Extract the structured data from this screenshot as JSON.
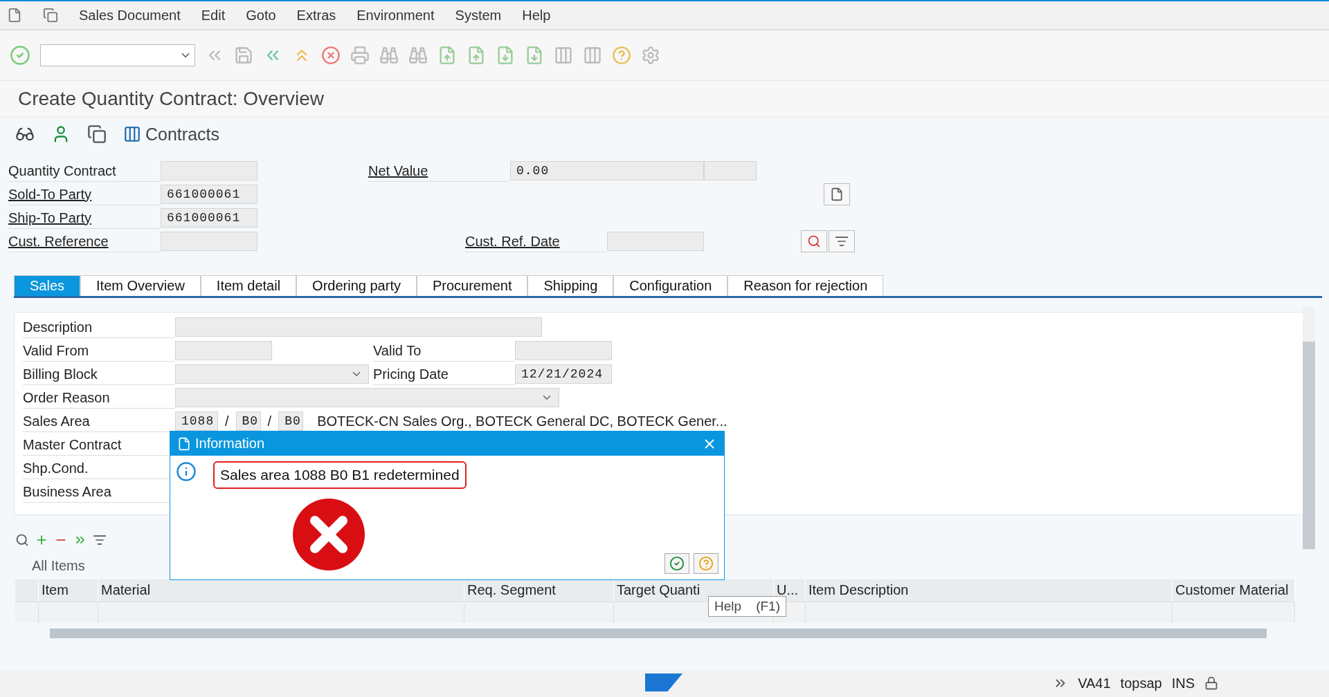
{
  "menu": [
    {
      "label": "Sales Document"
    },
    {
      "label": "Edit"
    },
    {
      "label": "Goto"
    },
    {
      "label": "Extras"
    },
    {
      "label": "Environment"
    },
    {
      "label": "System"
    },
    {
      "label": "Help"
    }
  ],
  "title": "Create Quantity Contract: Overview",
  "app_toolbar": {
    "label": "Contracts"
  },
  "header": {
    "rows": [
      {
        "left": {
          "label": "Quantity Contract",
          "link": false
        },
        "right": {
          "label": "Net Value",
          "link": true,
          "value": "0.00"
        }
      },
      {
        "left": {
          "label": "Sold-To Party",
          "link": true,
          "value": "661000061"
        }
      },
      {
        "left": {
          "label": "Ship-To Party",
          "link": true,
          "value": "661000061"
        }
      },
      {
        "left": {
          "label": "Cust. Reference",
          "link": true
        },
        "right": {
          "label": "Cust. Ref. Date",
          "link": true
        }
      }
    ]
  },
  "tabs": [
    {
      "label": "Sales",
      "selected": true
    },
    {
      "label": "Item Overview",
      "selected": false
    },
    {
      "label": "Item detail",
      "selected": false
    },
    {
      "label": "Ordering party",
      "selected": false
    },
    {
      "label": "Procurement",
      "selected": false
    },
    {
      "label": "Shipping",
      "selected": false
    },
    {
      "label": "Configuration",
      "selected": false
    },
    {
      "label": "Reason for rejection",
      "selected": false
    }
  ],
  "sales": {
    "rows": [
      {
        "label": "Description",
        "kind": "wide"
      },
      {
        "label": "Valid From",
        "kind": "short",
        "right": {
          "label": "Valid To"
        }
      },
      {
        "label": "Billing Block",
        "kind": "dropdown",
        "right": {
          "label": "Pricing Date",
          "value": "12/21/2024"
        }
      },
      {
        "label": "Order Reason",
        "kind": "longdropdown"
      },
      {
        "label": "Sales Area",
        "kind": "area",
        "parts": [
          "1088",
          "B0",
          "B0"
        ],
        "separator": "/",
        "text": "BOTECK-CN Sales Org., BOTECK General DC, BOTECK Gener..."
      },
      {
        "label": "Master Contract",
        "kind": "short"
      },
      {
        "label": "Shp.Cond.",
        "kind": "hidden"
      },
      {
        "label": "Business Area",
        "kind": "hidden"
      }
    ]
  },
  "items": {
    "title": "All Items",
    "columns": [
      "Item",
      "Material",
      "Req. Segment",
      "Target Quanti",
      "U...",
      "Item Description",
      "Customer Material"
    ]
  },
  "dialog": {
    "title": "Information",
    "message": "Sales area 1088 B0 B1 redetermined"
  },
  "tooltip": "Help    (F1)",
  "status": {
    "transaction": "VA41",
    "user": "topsap",
    "mode": "INS"
  }
}
